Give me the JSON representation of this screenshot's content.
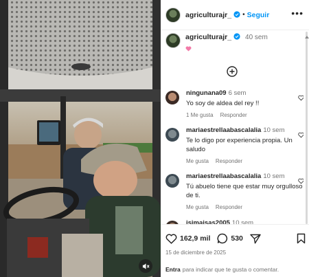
{
  "post": {
    "username": "agriculturajr_",
    "follow_label": "Seguir",
    "more_icon": "more-horizontal-icon",
    "caption_time": "40 sem",
    "caption_emoji": "💗"
  },
  "comments": [
    {
      "user": "ningunana09",
      "time": "6 sem",
      "text": "Yo soy de aldea del rey !!",
      "likes": "1 Me gusta",
      "reply": "Responder"
    },
    {
      "user": "mariaestrellaabascalalia",
      "time": "10 sem",
      "text": "Te lo digo por experiencia propia. Un saludo",
      "like": "Me gusta",
      "reply": "Responder"
    },
    {
      "user": "mariaestrellaabascalalia",
      "time": "10 sem",
      "text": "Tú abuelo tiene que estar muy orgulloso de ti.",
      "like": "Me gusta",
      "reply": "Responder"
    },
    {
      "user": "isimaisas2005",
      "time": "10 sem"
    }
  ],
  "stats": {
    "likes": "162,9 mil",
    "comments": "530",
    "date": "15 de diciembre de 2025"
  },
  "login": {
    "link": "Entra",
    "rest": "para indicar que te gusta o comentar."
  },
  "colors": {
    "accent": "#0095f6",
    "text": "#262626",
    "muted": "#737373"
  }
}
